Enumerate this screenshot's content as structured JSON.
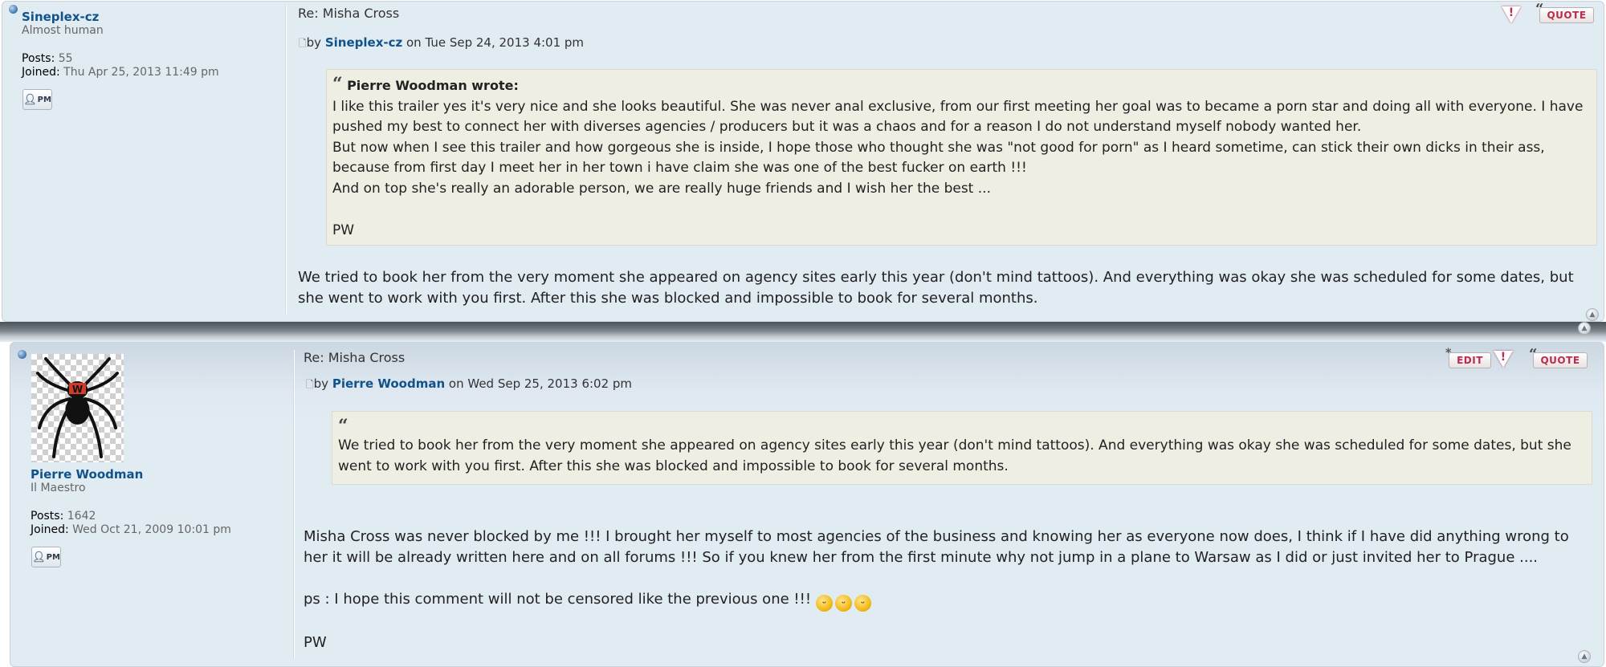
{
  "posts": [
    {
      "author": {
        "name": "Sineplex-cz",
        "rank": "Almost human",
        "posts_label": "Posts:",
        "posts_value": "55",
        "joined_label": "Joined:",
        "joined_value": "Thu Apr 25, 2013 11:49 pm",
        "pm_label": "PM"
      },
      "title": "Re: Misha Cross",
      "meta_by": "by",
      "meta_author": "Sineplex-cz",
      "meta_date": "on Tue Sep 24, 2013 4:01 pm",
      "actions": {
        "quote_label": "QUOTE"
      },
      "quote": {
        "cite": "Pierre Woodman wrote:",
        "lines": [
          "I like this trailer yes it's very nice and she looks beautiful. She was never anal exclusive, from our first meeting her goal was to became a porn star and doing all with everyone. I have pushed my best to connect her with diverses agencies / producers but it was a chaos and for a reason I do not understand myself nobody wanted her.",
          "But now when I see this trailer and how gorgeous she is inside, I hope those who thought she was \"not good for porn\" as I heard sometime, can stick their own dicks in their ass, because from first day I meet her in her town i have claim she was one of the best fucker on earth !!!",
          "And on top she's really an adorable person, we are really huge friends and I wish her the best ...",
          "PW"
        ]
      },
      "body": "We tried to book her from the very moment she appeared on agency sites early this year (don't mind tattoos). And everything was okay she was scheduled for some dates, but she went to work with you first. After this she was blocked and impossible to book for several months."
    },
    {
      "author": {
        "name": "Pierre Woodman",
        "rank": "Il Maestro",
        "posts_label": "Posts:",
        "posts_value": "1642",
        "joined_label": "Joined:",
        "joined_value": "Wed Oct 21, 2009 10:01 pm",
        "pm_label": "PM"
      },
      "title": "Re: Misha Cross",
      "meta_by": "by",
      "meta_author": "Pierre Woodman",
      "meta_date": "on Wed Sep 25, 2013 6:02 pm",
      "actions": {
        "edit_label": "EDIT",
        "quote_label": "QUOTE"
      },
      "quote": {
        "text": "We tried to book her from the very moment she appeared on agency sites early this year (don't mind tattoos). And everything was okay she was scheduled for some dates, but she went to work with you first. After this she was blocked and impossible to book for several months."
      },
      "body_para1": "Misha Cross was never blocked by me !!! I brought her myself to most agencies of the business and knowing her as everyone now does, I think if I have did anything wrong to her it will be already written here and on all forums !!! So if you knew her from the first minute why not jump in a plane to Warsaw as I did or just invited her to Prague ....",
      "body_para2": "ps : I hope this comment will not be censored like the previous one !!!",
      "body_para3": "PW"
    }
  ]
}
